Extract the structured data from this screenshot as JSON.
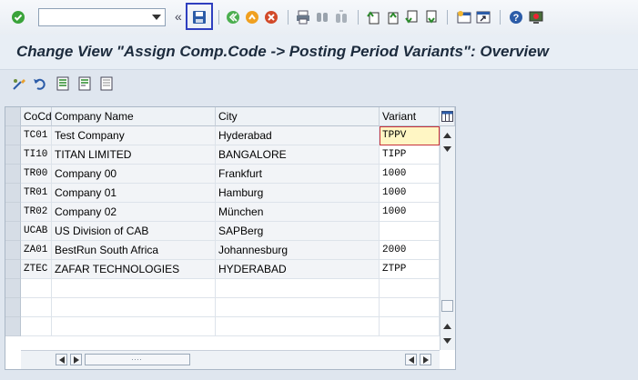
{
  "toolbar": {
    "command_field": {
      "value": "",
      "placeholder": ""
    },
    "icons": [
      "enter-icon",
      "back-icon",
      "exit-icon",
      "cancel-icon",
      "print-icon",
      "find-icon",
      "find-next-icon",
      "first-page-icon",
      "previous-page-icon",
      "next-page-icon",
      "last-page-icon",
      "create-session-icon",
      "shortcut-icon",
      "help-icon",
      "customize-layout-icon"
    ]
  },
  "title": "Change View \"Assign Comp.Code -> Posting Period Variants\": Overview",
  "table": {
    "headers": {
      "cocd": "CoCd",
      "name": "Company Name",
      "city": "City",
      "variant": "Variant"
    },
    "rows": [
      {
        "cocd": "TC01",
        "name": "Test Company",
        "city": "Hyderabad",
        "variant": "TPPV"
      },
      {
        "cocd": "TI10",
        "name": "TITAN LIMITED",
        "city": "BANGALORE",
        "variant": "TIPP"
      },
      {
        "cocd": "TR00",
        "name": "Company 00",
        "city": "Frankfurt",
        "variant": "1000"
      },
      {
        "cocd": "TR01",
        "name": "Company 01",
        "city": "Hamburg",
        "variant": "1000"
      },
      {
        "cocd": "TR02",
        "name": "Company 02",
        "city": "München",
        "variant": "1000"
      },
      {
        "cocd": "UCAB",
        "name": "US Division of CAB",
        "city": "SAPBerg",
        "variant": ""
      },
      {
        "cocd": "ZA01",
        "name": "BestRun South Africa",
        "city": "Johannesburg",
        "variant": "2000"
      },
      {
        "cocd": "ZTEC",
        "name": "ZAFAR TECHNOLOGIES",
        "city": "HYDERABAD",
        "variant": "ZTPP"
      }
    ]
  },
  "colors": {
    "save_highlight": "#2f3fbf",
    "focus_cell": "#fff6c4"
  }
}
